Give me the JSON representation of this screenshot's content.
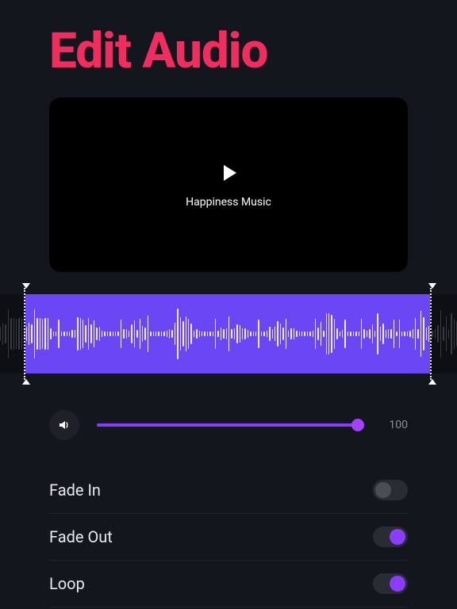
{
  "title": "Edit Audio",
  "player": {
    "track_title": "Happiness Music"
  },
  "volume": {
    "value": "100"
  },
  "options": [
    {
      "label": "Fade In",
      "on": false
    },
    {
      "label": "Fade Out",
      "on": true
    },
    {
      "label": "Loop",
      "on": true
    }
  ]
}
